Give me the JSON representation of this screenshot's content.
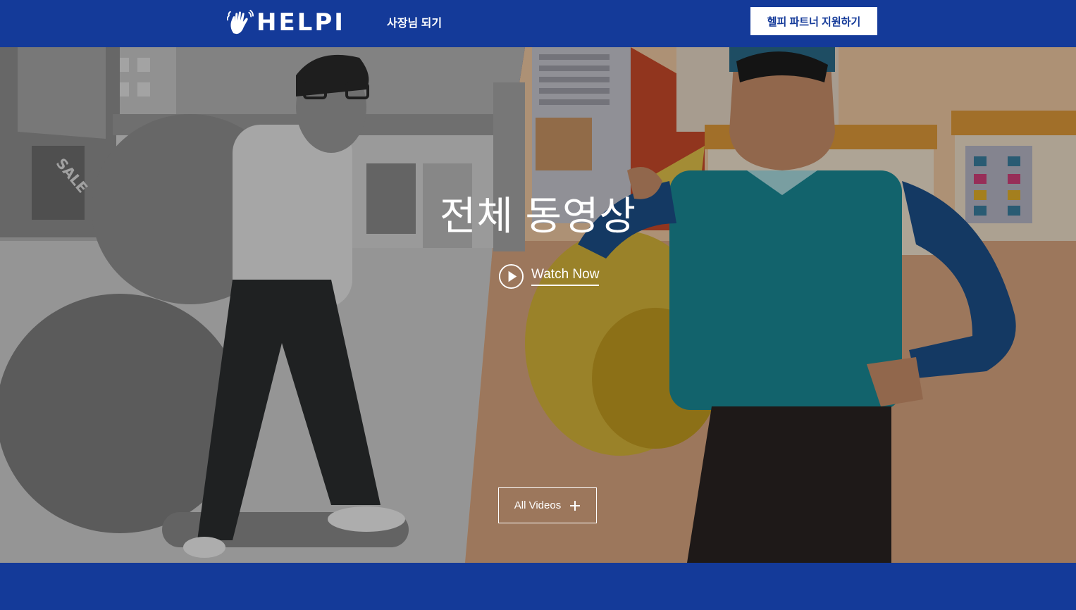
{
  "header": {
    "logo_text": "HELPI",
    "logo_icon": "waving-hand-icon",
    "nav_link_label": "사장님 되기",
    "cta_label": "헬피 파트너 지원하기"
  },
  "hero": {
    "title": "전체 동영상",
    "watch_now_label": "Watch Now",
    "watch_now_icon": "play-circle-icon",
    "all_videos_label": "All Videos",
    "all_videos_icon": "plus-icon",
    "illustration_sign_text": "SALE"
  },
  "colors": {
    "brand_blue": "#143a99",
    "white": "#ffffff"
  }
}
